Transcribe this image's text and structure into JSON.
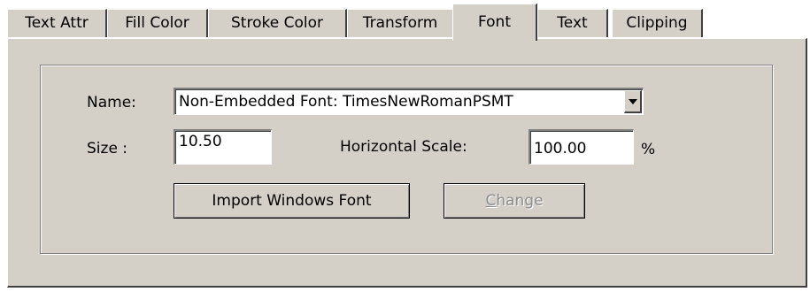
{
  "tabs": [
    {
      "label": "Text Attr",
      "active": false
    },
    {
      "label": "Fill Color",
      "active": false
    },
    {
      "label": "Stroke Color",
      "active": false
    },
    {
      "label": "Transform",
      "active": false
    },
    {
      "label": "Font",
      "active": true
    },
    {
      "label": "Text",
      "active": false
    },
    {
      "label": "Clipping",
      "active": false
    }
  ],
  "font": {
    "name_label": "Name:",
    "name_value": "Non-Embedded Font: TimesNewRomanPSMT",
    "size_label": "Size :",
    "size_value": "10.50",
    "hscale_label": "Horizontal Scale:",
    "hscale_value": "100.00",
    "hscale_unit": "%",
    "import_button": "Import Windows Font",
    "change_button_prefix": "",
    "change_button_mnemonic": "C",
    "change_button_rest": "hange"
  }
}
